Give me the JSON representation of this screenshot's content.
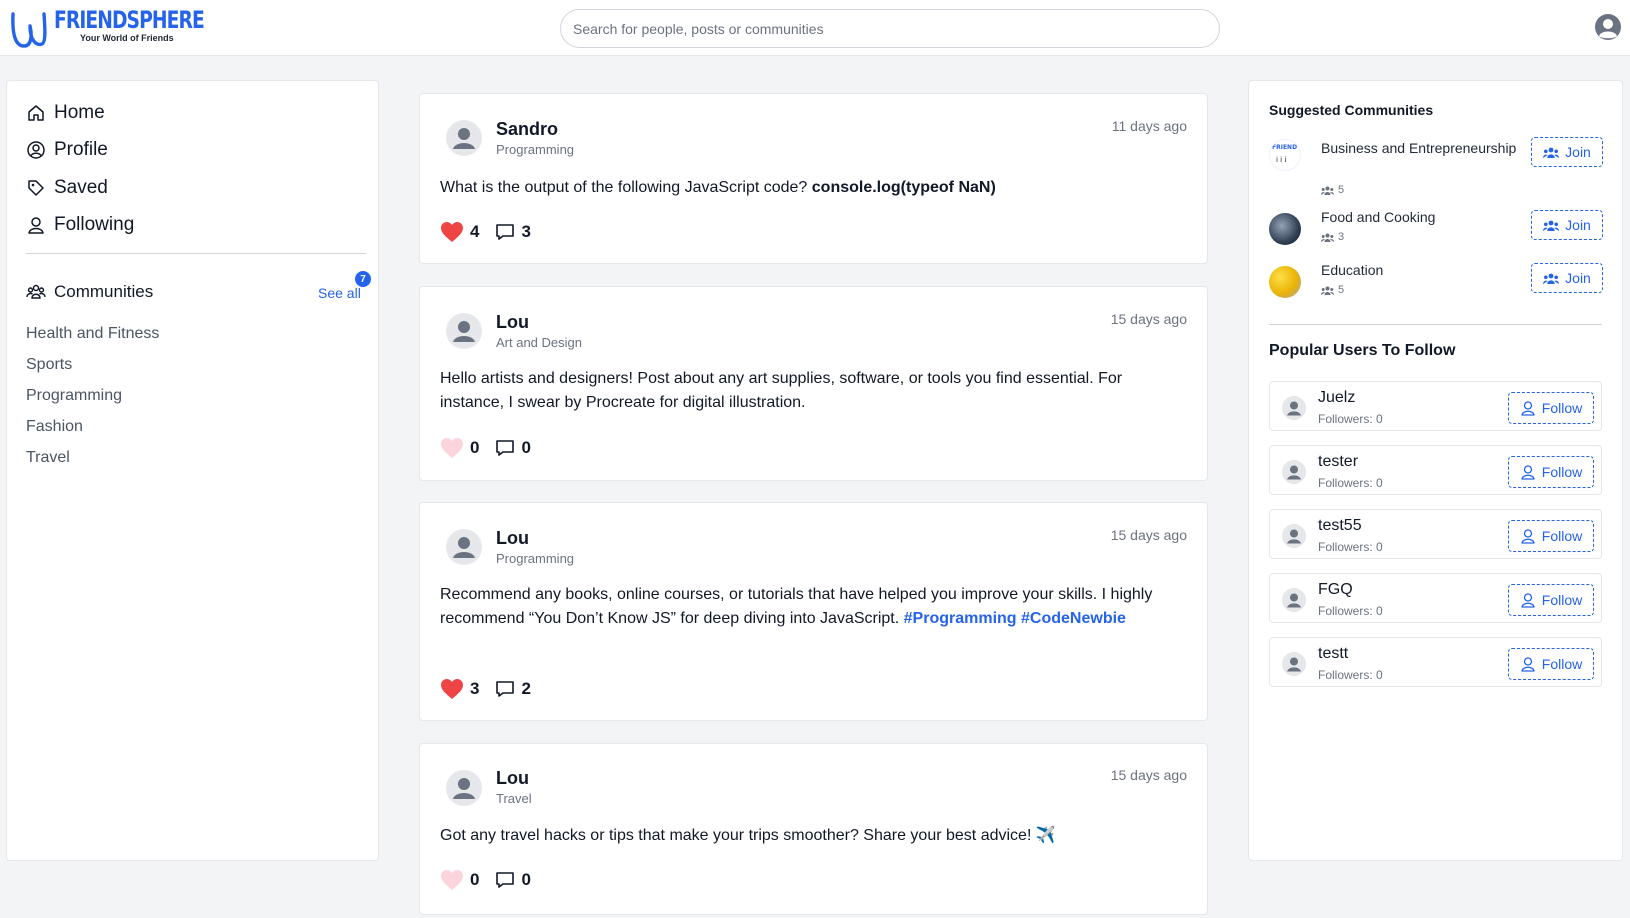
{
  "app": {
    "name": "FRIENDSPHERE",
    "tagline": "Your World of Friends",
    "brand_color": "#2563eb"
  },
  "search": {
    "placeholder": "Search for people, posts or communities"
  },
  "nav": {
    "items": [
      {
        "label": "Home",
        "icon": "home-icon"
      },
      {
        "label": "Profile",
        "icon": "user-circle-icon"
      },
      {
        "label": "Saved",
        "icon": "tag-icon"
      },
      {
        "label": "Following",
        "icon": "user-icon"
      }
    ]
  },
  "communities": {
    "title": "Communities",
    "see_all": "See all",
    "badge": "7",
    "items": [
      "Health and Fitness",
      "Sports",
      "Programming",
      "Fashion",
      "Travel"
    ]
  },
  "posts": [
    {
      "author": "Sandro",
      "category": "Programming",
      "time": "11 days ago",
      "text": "What is the output of the following JavaScript code? ",
      "code": "console.log(typeof NaN)",
      "likes": "4",
      "comments": "3",
      "liked": true
    },
    {
      "author": "Lou",
      "category": "Art and Design",
      "time": "15 days ago",
      "text": "Hello artists and designers! Post about any art supplies, software, or tools you find essential. For instance, I swear by Procreate for digital illustration.",
      "likes": "0",
      "comments": "0",
      "liked": false
    },
    {
      "author": "Lou",
      "category": "Programming",
      "time": "15 days ago",
      "text": "Recommend any books, online courses, or tutorials that have helped you improve your skills. I highly recommend “You Don’t Know JS” for deep diving into JavaScript. ",
      "hashtags": [
        "#Programming",
        "#CodeNewbie"
      ],
      "likes": "3",
      "comments": "2",
      "liked": true
    },
    {
      "author": "Lou",
      "category": "Travel",
      "time": "15 days ago",
      "text": "Got any travel hacks or tips that make your trips smoother? Share your best advice! ",
      "emoji": "✈️",
      "likes": "0",
      "comments": "0",
      "liked": false
    }
  ],
  "suggested": {
    "title": "Suggested Communities",
    "join_label": "Join",
    "items": [
      {
        "name": "Business and Entrepreneurship",
        "members": "5"
      },
      {
        "name": "Food and Cooking",
        "members": "3"
      },
      {
        "name": "Education",
        "members": "5"
      }
    ]
  },
  "popular": {
    "title": "Popular Users To Follow",
    "follow_label": "Follow",
    "users": [
      {
        "name": "Juelz",
        "followers": "Followers: 0"
      },
      {
        "name": "tester",
        "followers": "Followers: 0"
      },
      {
        "name": "test55",
        "followers": "Followers: 0"
      },
      {
        "name": "FGQ",
        "followers": "Followers: 0"
      },
      {
        "name": "testt",
        "followers": "Followers: 0"
      }
    ]
  }
}
